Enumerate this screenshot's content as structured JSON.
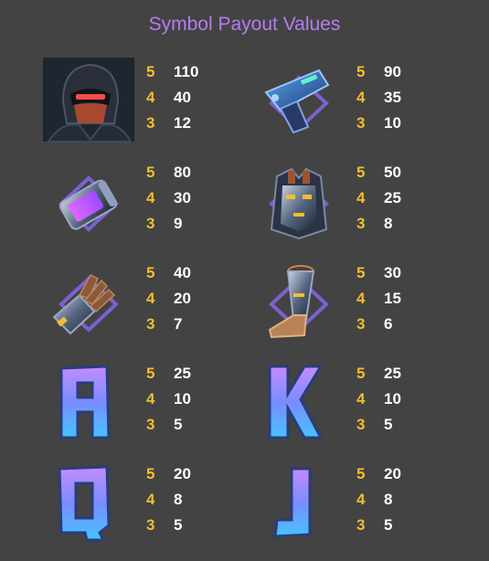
{
  "title": "Symbol Payout Values",
  "colors": {
    "background": "#434343",
    "title": "#b57cf0",
    "count": "#f2be2e",
    "value": "#ffffff"
  },
  "symbols": [
    {
      "icon": "hooded-agent-icon",
      "pays": [
        {
          "count": "5",
          "value": "110"
        },
        {
          "count": "4",
          "value": "40"
        },
        {
          "count": "3",
          "value": "12"
        }
      ]
    },
    {
      "icon": "blaster-pistol-icon",
      "pays": [
        {
          "count": "5",
          "value": "90"
        },
        {
          "count": "4",
          "value": "35"
        },
        {
          "count": "3",
          "value": "10"
        }
      ]
    },
    {
      "icon": "power-cell-icon",
      "pays": [
        {
          "count": "5",
          "value": "80"
        },
        {
          "count": "4",
          "value": "30"
        },
        {
          "count": "3",
          "value": "9"
        }
      ]
    },
    {
      "icon": "armor-vest-icon",
      "pays": [
        {
          "count": "5",
          "value": "50"
        },
        {
          "count": "4",
          "value": "25"
        },
        {
          "count": "3",
          "value": "8"
        }
      ]
    },
    {
      "icon": "robotic-gauntlet-icon",
      "pays": [
        {
          "count": "5",
          "value": "40"
        },
        {
          "count": "4",
          "value": "20"
        },
        {
          "count": "3",
          "value": "7"
        }
      ]
    },
    {
      "icon": "armored-boot-icon",
      "pays": [
        {
          "count": "5",
          "value": "30"
        },
        {
          "count": "4",
          "value": "15"
        },
        {
          "count": "3",
          "value": "6"
        }
      ]
    },
    {
      "icon": "letter-a-icon",
      "pays": [
        {
          "count": "5",
          "value": "25"
        },
        {
          "count": "4",
          "value": "10"
        },
        {
          "count": "3",
          "value": "5"
        }
      ]
    },
    {
      "icon": "letter-k-icon",
      "pays": [
        {
          "count": "5",
          "value": "25"
        },
        {
          "count": "4",
          "value": "10"
        },
        {
          "count": "3",
          "value": "5"
        }
      ]
    },
    {
      "icon": "letter-q-icon",
      "pays": [
        {
          "count": "5",
          "value": "20"
        },
        {
          "count": "4",
          "value": "8"
        },
        {
          "count": "3",
          "value": "5"
        }
      ]
    },
    {
      "icon": "letter-j-icon",
      "pays": [
        {
          "count": "5",
          "value": "20"
        },
        {
          "count": "4",
          "value": "8"
        },
        {
          "count": "3",
          "value": "5"
        }
      ]
    }
  ]
}
